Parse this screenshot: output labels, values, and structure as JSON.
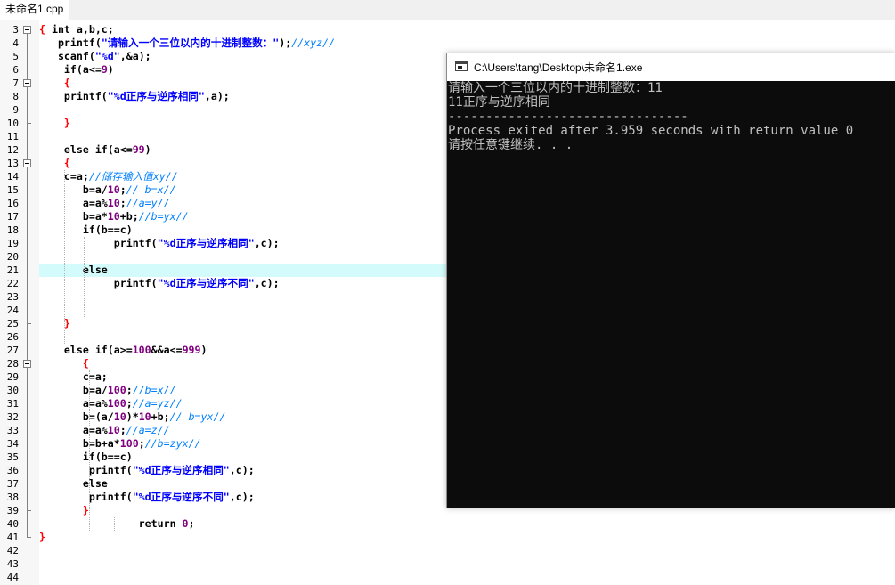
{
  "tab": {
    "label": "未命名1.cpp"
  },
  "editor": {
    "highlight_line": 21,
    "lines": [
      {
        "n": "3",
        "seg": [
          [
            "sym",
            "{ "
          ],
          [
            "kw",
            "int a,b,c;"
          ]
        ]
      },
      {
        "n": "4",
        "seg": [
          [
            "kw",
            "   printf("
          ],
          [
            "str",
            "\"请输入一个三位以内的十进制整数：\""
          ],
          [
            "kw",
            ");"
          ],
          [
            "cmt",
            "//xyz//"
          ]
        ]
      },
      {
        "n": "5",
        "seg": [
          [
            "kw",
            "   scanf("
          ],
          [
            "str",
            "\"%d\""
          ],
          [
            "kw",
            ",&a);"
          ]
        ]
      },
      {
        "n": "6",
        "seg": [
          [
            "kw",
            "    if(a<="
          ],
          [
            "num",
            "9"
          ],
          [
            "kw",
            ")"
          ]
        ]
      },
      {
        "n": "7",
        "seg": [
          [
            "sym",
            "    {"
          ]
        ]
      },
      {
        "n": "8",
        "seg": [
          [
            "kw",
            "    printf("
          ],
          [
            "str",
            "\"%d正序与逆序相同\""
          ],
          [
            "kw",
            ",a);"
          ]
        ]
      },
      {
        "n": "9",
        "seg": []
      },
      {
        "n": "10",
        "seg": [
          [
            "sym",
            "    }"
          ]
        ]
      },
      {
        "n": "11",
        "seg": []
      },
      {
        "n": "12",
        "seg": [
          [
            "kw",
            "    else if(a<="
          ],
          [
            "num",
            "99"
          ],
          [
            "kw",
            ")"
          ]
        ]
      },
      {
        "n": "13",
        "seg": [
          [
            "sym",
            "    {"
          ]
        ]
      },
      {
        "n": "14",
        "seg": [
          [
            "kw",
            "    c=a;"
          ],
          [
            "cmt",
            "//储存输入值xy//"
          ]
        ]
      },
      {
        "n": "15",
        "seg": [
          [
            "kw",
            "       b=a/"
          ],
          [
            "num",
            "10"
          ],
          [
            "kw",
            ";"
          ],
          [
            "cmt",
            "// b=x//"
          ]
        ]
      },
      {
        "n": "16",
        "seg": [
          [
            "kw",
            "       a=a%"
          ],
          [
            "num",
            "10"
          ],
          [
            "kw",
            ";"
          ],
          [
            "cmt",
            "//a=y//"
          ]
        ]
      },
      {
        "n": "17",
        "seg": [
          [
            "kw",
            "       b=a*"
          ],
          [
            "num",
            "10"
          ],
          [
            "kw",
            "+b;"
          ],
          [
            "cmt",
            "//b=yx//"
          ]
        ]
      },
      {
        "n": "18",
        "seg": [
          [
            "kw",
            "       if(b==c)"
          ]
        ]
      },
      {
        "n": "19",
        "seg": [
          [
            "kw",
            "            printf("
          ],
          [
            "str",
            "\"%d正序与逆序相同\""
          ],
          [
            "kw",
            ",c);"
          ]
        ]
      },
      {
        "n": "20",
        "seg": []
      },
      {
        "n": "21",
        "seg": [
          [
            "kw",
            "       else"
          ]
        ]
      },
      {
        "n": "22",
        "seg": [
          [
            "kw",
            "            printf("
          ],
          [
            "str",
            "\"%d正序与逆序不同\""
          ],
          [
            "kw",
            ",c);"
          ]
        ]
      },
      {
        "n": "23",
        "seg": []
      },
      {
        "n": "24",
        "seg": []
      },
      {
        "n": "25",
        "seg": [
          [
            "sym",
            "    }"
          ]
        ]
      },
      {
        "n": "26",
        "seg": []
      },
      {
        "n": "27",
        "seg": [
          [
            "kw",
            "    else if(a>="
          ],
          [
            "num",
            "100"
          ],
          [
            "kw",
            "&&a<="
          ],
          [
            "num",
            "999"
          ],
          [
            "kw",
            ")"
          ]
        ]
      },
      {
        "n": "28",
        "seg": [
          [
            "sym",
            "       {"
          ]
        ]
      },
      {
        "n": "29",
        "seg": [
          [
            "kw",
            "       c=a;"
          ]
        ]
      },
      {
        "n": "30",
        "seg": [
          [
            "kw",
            "       b=a/"
          ],
          [
            "num",
            "100"
          ],
          [
            "kw",
            ";"
          ],
          [
            "cmt",
            "//b=x//"
          ]
        ]
      },
      {
        "n": "31",
        "seg": [
          [
            "kw",
            "       a=a%"
          ],
          [
            "num",
            "100"
          ],
          [
            "kw",
            ";"
          ],
          [
            "cmt",
            "//a=yz//"
          ]
        ]
      },
      {
        "n": "32",
        "seg": [
          [
            "kw",
            "       b=(a/"
          ],
          [
            "num",
            "10"
          ],
          [
            "kw",
            ")*"
          ],
          [
            "num",
            "10"
          ],
          [
            "kw",
            "+b;"
          ],
          [
            "cmt",
            "// b=yx//"
          ]
        ]
      },
      {
        "n": "33",
        "seg": [
          [
            "kw",
            "       a=a%"
          ],
          [
            "num",
            "10"
          ],
          [
            "kw",
            ";"
          ],
          [
            "cmt",
            "//a=z//"
          ]
        ]
      },
      {
        "n": "34",
        "seg": [
          [
            "kw",
            "       b=b+a*"
          ],
          [
            "num",
            "100"
          ],
          [
            "kw",
            ";"
          ],
          [
            "cmt",
            "//b=zyx//"
          ]
        ]
      },
      {
        "n": "35",
        "seg": [
          [
            "kw",
            "       if(b==c)"
          ]
        ]
      },
      {
        "n": "36",
        "seg": [
          [
            "kw",
            "        printf("
          ],
          [
            "str",
            "\"%d正序与逆序相同\""
          ],
          [
            "kw",
            ",c);"
          ]
        ]
      },
      {
        "n": "37",
        "seg": [
          [
            "kw",
            "       else"
          ]
        ]
      },
      {
        "n": "38",
        "seg": [
          [
            "kw",
            "        printf("
          ],
          [
            "str",
            "\"%d正序与逆序不同\""
          ],
          [
            "kw",
            ",c);"
          ]
        ]
      },
      {
        "n": "39",
        "seg": [
          [
            "sym",
            "       }"
          ]
        ]
      },
      {
        "n": "40",
        "seg": [
          [
            "kw",
            "                return "
          ],
          [
            "num",
            "0"
          ],
          [
            "kw",
            ";"
          ]
        ]
      },
      {
        "n": "41",
        "seg": [
          [
            "sym",
            "}"
          ]
        ]
      },
      {
        "n": "42",
        "seg": []
      },
      {
        "n": "43",
        "seg": []
      },
      {
        "n": "44",
        "seg": []
      }
    ]
  },
  "console": {
    "title": "C:\\Users\\tang\\Desktop\\未命名1.exe",
    "lines": [
      "请输入一个三位以内的十进制整数：11",
      "11正序与逆序相同",
      "--------------------------------",
      "Process exited after 3.959 seconds with return value 0",
      "请按任意键继续. . ."
    ]
  }
}
